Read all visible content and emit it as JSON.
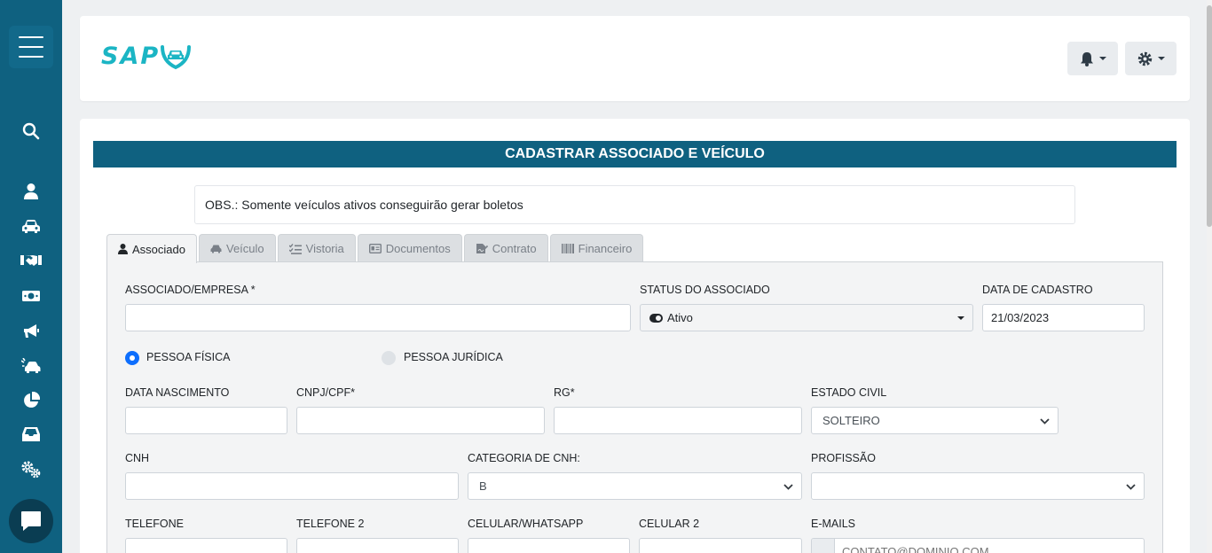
{
  "header": {
    "logo_text": "SAP"
  },
  "page": {
    "title": "CADASTRAR ASSOCIADO E VEÍCULO",
    "obs": "OBS.: Somente veículos ativos conseguirão gerar boletos"
  },
  "tabs": [
    {
      "label": "Associado",
      "icon": "user-icon"
    },
    {
      "label": "Veículo",
      "icon": "car-icon"
    },
    {
      "label": "Vistoria",
      "icon": "checklist-icon"
    },
    {
      "label": "Documentos",
      "icon": "id-card-icon"
    },
    {
      "label": "Contrato",
      "icon": "signature-icon"
    },
    {
      "label": "Financeiro",
      "icon": "barcode-icon"
    }
  ],
  "form": {
    "associado_label": "ASSOCIADO/EMPRESA *",
    "associado_value": "",
    "status_label": "STATUS DO ASSOCIADO",
    "status_value": "Ativo",
    "data_cadastro_label": "DATA DE CADASTRO",
    "data_cadastro_value": "21/03/2023",
    "pessoa_fisica": "PESSOA FÍSICA",
    "pessoa_juridica": "PESSOA JURÍDICA",
    "data_nascimento_label": "DATA NASCIMENTO",
    "cnpj_cpf_label": "CNPJ/CPF*",
    "rg_label": "RG*",
    "estado_civil_label": "ESTADO CIVIL",
    "estado_civil_value": "SOLTEIRO",
    "cnh_label": "CNH",
    "categoria_cnh_label": "CATEGORIA DE CNH:",
    "categoria_cnh_value": "B",
    "profissao_label": "PROFISSÃO",
    "profissao_value": "",
    "telefone_label": "TELEFONE",
    "telefone2_label": "TELEFONE 2",
    "celular_label": "CELULAR/WHATSAPP",
    "celular2_label": "CELULAR 2",
    "emails_label": "E-MAILS",
    "emails_placeholder": "CONTATO@DOMINIO.COM"
  },
  "colors": {
    "sidebar": "#0f6180",
    "accent": "#0f6180",
    "logo": "#1bb5c4",
    "radio_active": "#0d6efd"
  }
}
